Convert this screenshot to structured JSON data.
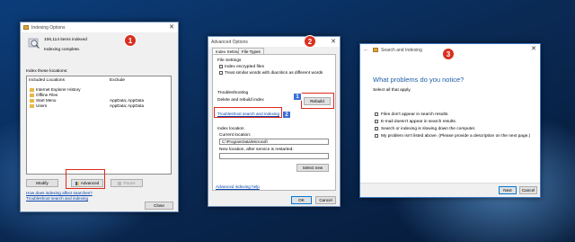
{
  "badges": {
    "one": "1",
    "two": "2",
    "three": "3",
    "sq1": "1",
    "sq2": "2"
  },
  "indexing": {
    "title": "Indexing Options",
    "items_indexed": "106,114 items indexed",
    "status": "Indexing complete.",
    "locations_label": "Index these locations:",
    "col_included": "Included Locations",
    "col_exclude": "Exclude",
    "locations": [
      {
        "name": "Internet Explorer History",
        "exclude": ""
      },
      {
        "name": "Offline Files",
        "exclude": ""
      },
      {
        "name": "Start Menu",
        "exclude": "AppData; AppData"
      },
      {
        "name": "Users",
        "exclude": "AppData; AppData"
      }
    ],
    "modify": "Modify",
    "advanced": "Advanced",
    "pause": "Pause",
    "link_affect": "How does indexing affect searches?",
    "link_troubleshoot": "Troubleshoot search and indexing",
    "close": "Close"
  },
  "advanced": {
    "title": "Advanced Options",
    "tab_settings": "Index Settings",
    "tab_filetypes": "File Types",
    "file_settings_label": "File Settings",
    "opt_encrypted": "Index encrypted files",
    "opt_diacritics": "Treat similar words with diacritics as different words",
    "troubleshooting_label": "Troubleshooting",
    "delete_rebuild": "Delete and rebuild index",
    "rebuild": "Rebuild",
    "troubleshoot_link": "Troubleshoot search and indexing",
    "index_location_label": "Index location",
    "current_location_label": "Current location:",
    "current_location": "C:\\ProgramData\\Microsoft",
    "new_location_label": "New location, after service is restarted:",
    "select_new": "Select new",
    "help_link": "Advanced indexing help",
    "ok": "OK",
    "cancel": "Cancel"
  },
  "wizard": {
    "title": "Search and Indexing",
    "heading": "What problems do you notice?",
    "instruction": "Select all that apply.",
    "options": [
      "Files don't appear in search results.",
      "E-mail doesn't appear in search results.",
      "Search or indexing is slowing down the computer.",
      "My problem isn't listed above. (Please provide a description on the next page.)"
    ],
    "next": "Next",
    "cancel": "Cancel"
  },
  "colors": {
    "accent": "#0078d7",
    "highlight_red": "#e0281b",
    "badge_red": "#d9301f",
    "wizard_heading": "#1f5fa8"
  }
}
